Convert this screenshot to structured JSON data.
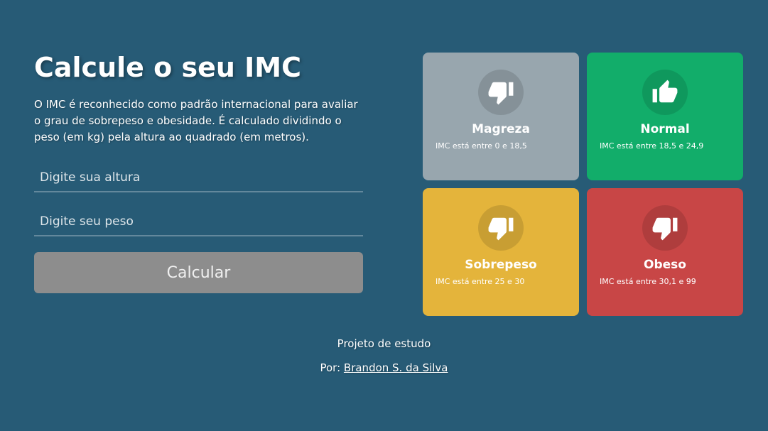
{
  "form": {
    "title": "Calcule o seu IMC",
    "description": "O IMC é reconhecido como padrão internacional para avaliar o grau de sobrepeso e obesidade. É calculado dividindo o peso (em kg) pela altura ao quadrado (em metros).",
    "height_placeholder": "Digite sua altura",
    "weight_placeholder": "Digite seu peso",
    "calculate_label": "Calcular"
  },
  "cards": [
    {
      "name": "Magreza",
      "rule": "IMC está entre 0 e 18,5",
      "icon": "thumbs-down-icon",
      "color": "#98a6ae"
    },
    {
      "name": "Normal",
      "rule": "IMC está entre 18,5 e 24,9",
      "icon": "thumbs-up-icon",
      "color": "#12ad6a"
    },
    {
      "name": "Sobrepeso",
      "rule": "IMC está entre 25 e 30",
      "icon": "thumbs-down-icon",
      "color": "#e4b43b"
    },
    {
      "name": "Obeso",
      "rule": "IMC está entre 30,1 e 99",
      "icon": "thumbs-down-icon",
      "color": "#c84646"
    }
  ],
  "footer": {
    "line1": "Projeto de estudo",
    "by_prefix": "Por: ",
    "author": "Brandon S. da Silva"
  },
  "colors": {
    "background": "#275b76",
    "button": "#8d8d8d"
  }
}
